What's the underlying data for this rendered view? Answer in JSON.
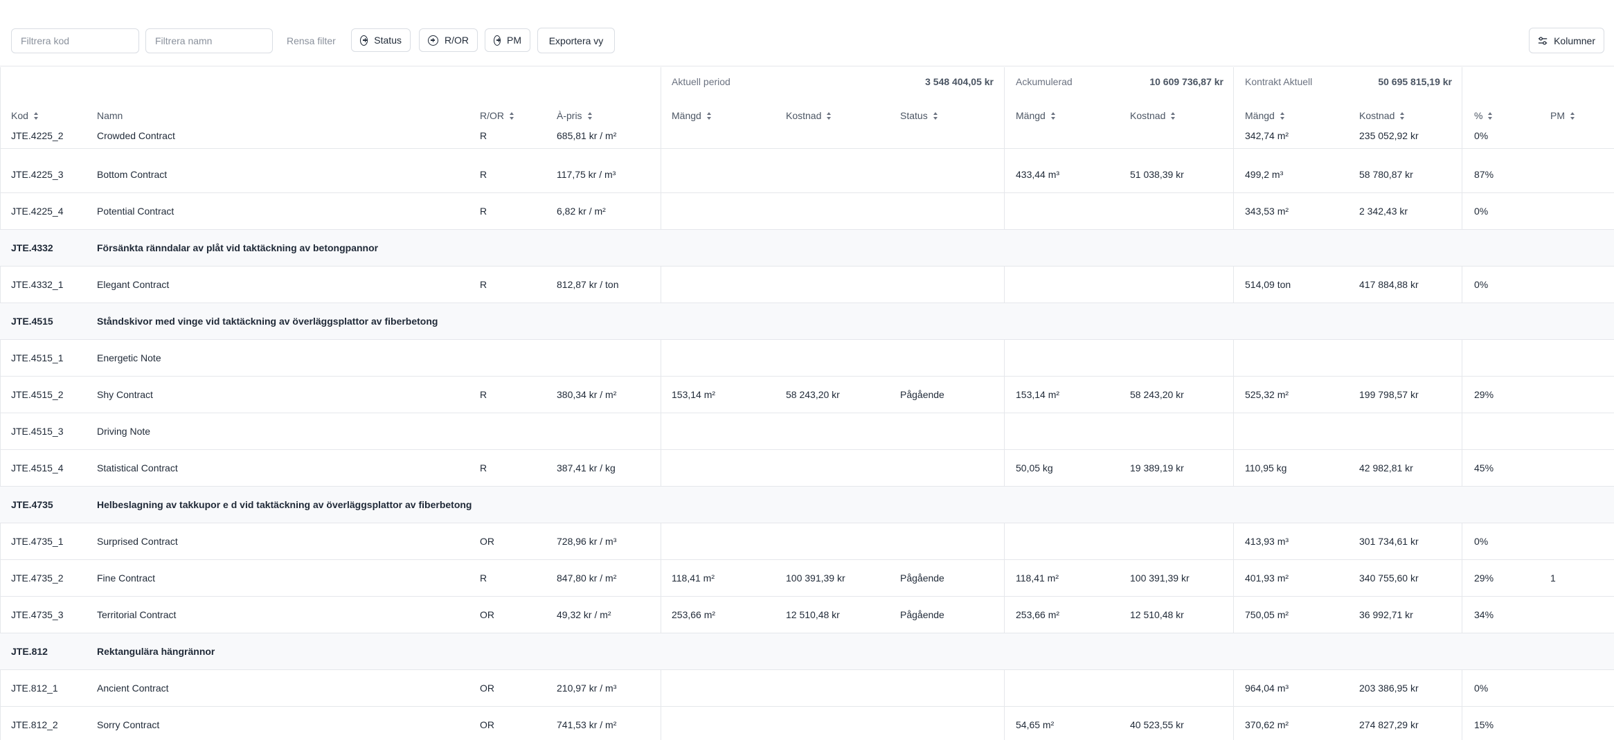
{
  "toolbar": {
    "filter_kod_placeholder": "Filtrera kod",
    "filter_namn_placeholder": "Filtrera namn",
    "clear_filter": "Rensa filter",
    "status_label": "Status",
    "ror_label": "R/OR",
    "pm_label": "PM",
    "export_label": "Exportera vy",
    "columns_label": "Kolumner"
  },
  "groups": {
    "current": {
      "label": "Aktuell period",
      "total": "3 548 404,05 kr"
    },
    "cumulative": {
      "label": "Ackumulerad",
      "total": "10 609 736,87 kr"
    },
    "contract": {
      "label": "Kontrakt Aktuell",
      "total": "50 695 815,19 kr"
    }
  },
  "columns": {
    "kod": "Kod",
    "namn": "Namn",
    "ror": "R/OR",
    "apris": "À-pris",
    "cur_mangd": "Mängd",
    "cur_kostnad": "Kostnad",
    "cur_status": "Status",
    "acc_mangd": "Mängd",
    "acc_kostnad": "Kostnad",
    "con_mangd": "Mängd",
    "con_kostnad": "Kostnad",
    "pct": "%",
    "pm": "PM"
  },
  "rows": [
    {
      "kod": "JTE.4225_2",
      "namn": "Crowded Contract",
      "ror": "R",
      "apris": "685,81 kr / m²",
      "cm": "",
      "ck": "",
      "cs": "",
      "am": "",
      "ak": "",
      "km": "342,74 m²",
      "kk": "235 052,92 kr",
      "pct": "0%",
      "pm": ""
    },
    {
      "kod": "JTE.4225_3",
      "namn": "Bottom Contract",
      "ror": "R",
      "apris": "117,75 kr / m³",
      "cm": "",
      "ck": "",
      "cs": "",
      "am": "433,44 m³",
      "ak": "51 038,39 kr",
      "km": "499,2 m³",
      "kk": "58 780,87 kr",
      "pct": "87%",
      "pm": ""
    },
    {
      "kod": "JTE.4225_4",
      "namn": "Potential Contract",
      "ror": "R",
      "apris": "6,82 kr / m²",
      "cm": "",
      "ck": "",
      "cs": "",
      "am": "",
      "ak": "",
      "km": "343,53 m²",
      "kk": "2 342,43 kr",
      "pct": "0%",
      "pm": ""
    },
    {
      "group": true,
      "kod": "JTE.4332",
      "namn": "Försänkta ränndalar av plåt vid taktäckning av betongpannor"
    },
    {
      "kod": "JTE.4332_1",
      "namn": "Elegant Contract",
      "ror": "R",
      "apris": "812,87 kr / ton",
      "cm": "",
      "ck": "",
      "cs": "",
      "am": "",
      "ak": "",
      "km": "514,09 ton",
      "kk": "417 884,88 kr",
      "pct": "0%",
      "pm": ""
    },
    {
      "group": true,
      "kod": "JTE.4515",
      "namn": "Ståndskivor med vinge vid taktäckning av överläggsplattor av fiberbetong"
    },
    {
      "kod": "JTE.4515_1",
      "namn": "Energetic Note",
      "ror": "",
      "apris": "",
      "cm": "",
      "ck": "",
      "cs": "",
      "am": "",
      "ak": "",
      "km": "",
      "kk": "",
      "pct": "",
      "pm": ""
    },
    {
      "kod": "JTE.4515_2",
      "namn": "Shy Contract",
      "ror": "R",
      "apris": "380,34 kr / m²",
      "cm": "153,14 m²",
      "ck": "58 243,20 kr",
      "cs": "Pågående",
      "am": "153,14 m²",
      "ak": "58 243,20 kr",
      "km": "525,32 m²",
      "kk": "199 798,57 kr",
      "pct": "29%",
      "pm": ""
    },
    {
      "kod": "JTE.4515_3",
      "namn": "Driving Note",
      "ror": "",
      "apris": "",
      "cm": "",
      "ck": "",
      "cs": "",
      "am": "",
      "ak": "",
      "km": "",
      "kk": "",
      "pct": "",
      "pm": ""
    },
    {
      "kod": "JTE.4515_4",
      "namn": "Statistical Contract",
      "ror": "R",
      "apris": "387,41 kr / kg",
      "cm": "",
      "ck": "",
      "cs": "",
      "am": "50,05 kg",
      "ak": "19 389,19 kr",
      "km": "110,95 kg",
      "kk": "42 982,81 kr",
      "pct": "45%",
      "pm": ""
    },
    {
      "group": true,
      "kod": "JTE.4735",
      "namn": "Helbeslagning av takkupor e d vid taktäckning av överläggsplattor av fiberbetong"
    },
    {
      "kod": "JTE.4735_1",
      "namn": "Surprised Contract",
      "ror": "OR",
      "apris": "728,96 kr / m³",
      "cm": "",
      "ck": "",
      "cs": "",
      "am": "",
      "ak": "",
      "km": "413,93 m³",
      "kk": "301 734,61 kr",
      "pct": "0%",
      "pm": ""
    },
    {
      "kod": "JTE.4735_2",
      "namn": "Fine Contract",
      "ror": "R",
      "apris": "847,80 kr / m²",
      "cm": "118,41 m²",
      "ck": "100 391,39 kr",
      "cs": "Pågående",
      "am": "118,41 m²",
      "ak": "100 391,39 kr",
      "km": "401,93 m²",
      "kk": "340 755,60 kr",
      "pct": "29%",
      "pm": "1"
    },
    {
      "kod": "JTE.4735_3",
      "namn": "Territorial Contract",
      "ror": "OR",
      "apris": "49,32 kr / m²",
      "cm": "253,66 m²",
      "ck": "12 510,48 kr",
      "cs": "Pågående",
      "am": "253,66 m²",
      "ak": "12 510,48 kr",
      "km": "750,05 m²",
      "kk": "36 992,71 kr",
      "pct": "34%",
      "pm": ""
    },
    {
      "group": true,
      "kod": "JTE.812",
      "namn": "Rektangulära hängrännor"
    },
    {
      "kod": "JTE.812_1",
      "namn": "Ancient Contract",
      "ror": "OR",
      "apris": "210,97 kr / m³",
      "cm": "",
      "ck": "",
      "cs": "",
      "am": "",
      "ak": "",
      "km": "964,04 m³",
      "kk": "203 386,95 kr",
      "pct": "0%",
      "pm": ""
    },
    {
      "kod": "JTE.812_2",
      "namn": "Sorry Contract",
      "ror": "OR",
      "apris": "741,53 kr / m²",
      "cm": "",
      "ck": "",
      "cs": "",
      "am": "54,65 m²",
      "ak": "40 523,55 kr",
      "km": "370,62 m²",
      "kk": "274 827,29 kr",
      "pct": "15%",
      "pm": ""
    }
  ]
}
